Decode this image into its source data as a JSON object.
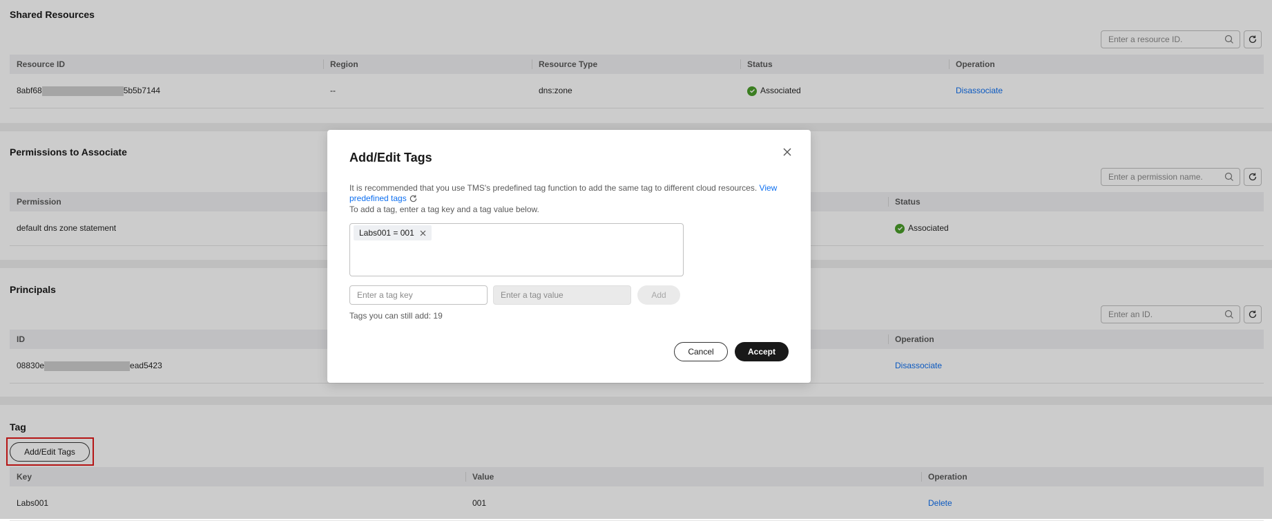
{
  "shared_resources": {
    "title": "Shared Resources",
    "search_placeholder": "Enter a resource ID.",
    "columns": [
      "Resource ID",
      "Region",
      "Resource Type",
      "Status",
      "Operation"
    ],
    "row": {
      "id_prefix": "8abf68",
      "id_suffix": "5b5b7144",
      "region": "--",
      "type": "dns:zone",
      "status": "Associated",
      "operation": "Disassociate"
    }
  },
  "permissions": {
    "title": "Permissions to Associate",
    "search_placeholder": "Enter a permission name.",
    "columns": [
      "Permission",
      "Status"
    ],
    "row": {
      "permission": "default dns zone statement",
      "status": "Associated"
    }
  },
  "principals": {
    "title": "Principals",
    "search_placeholder": "Enter an ID.",
    "columns": [
      "ID",
      "Operation"
    ],
    "row": {
      "id_prefix": "08830e",
      "id_suffix": "ead5423",
      "operation": "Disassociate"
    }
  },
  "tag_section": {
    "title": "Tag",
    "add_button": "Add/Edit Tags",
    "columns": [
      "Key",
      "Value",
      "Operation"
    ],
    "row": {
      "key": "Labs001",
      "value": "001",
      "operation": "Delete"
    }
  },
  "dialog": {
    "title": "Add/Edit Tags",
    "info_text": "It is recommended that you use TMS's predefined tag function to add the same tag to different cloud resources.",
    "info_link": "View predefined tags",
    "hint": "To add a tag, enter a tag key and a tag value below.",
    "chip": "Labs001 = 001",
    "key_placeholder": "Enter a tag key",
    "value_placeholder": "Enter a tag value",
    "add_label": "Add",
    "remaining": "Tags you can still add: 19",
    "cancel_label": "Cancel",
    "accept_label": "Accept"
  },
  "colors": {
    "link": "#0d6ff0",
    "success": "#4a9e2a",
    "highlight": "#e31b1b",
    "primary_button": "#191919"
  }
}
